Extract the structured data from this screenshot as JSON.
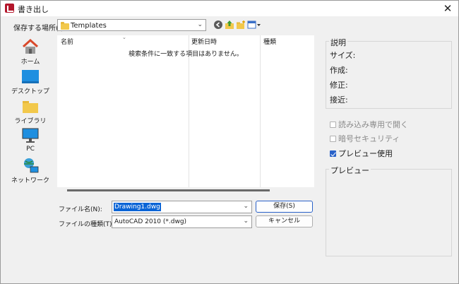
{
  "window": {
    "title": "書き出し"
  },
  "save_in": {
    "label": "保存する場所(I):",
    "value": "Templates"
  },
  "places": [
    {
      "label": "ホーム",
      "icon": "home-icon"
    },
    {
      "label": "デスクトップ",
      "icon": "desktop-icon"
    },
    {
      "label": "ライブラリ",
      "icon": "library-folder-icon"
    },
    {
      "label": "PC",
      "icon": "pc-monitor-icon"
    },
    {
      "label": "ネットワーク",
      "icon": "network-icon"
    }
  ],
  "file_list": {
    "columns": [
      "名前",
      "更新日時",
      "種類"
    ],
    "empty_message": "検索条件に一致する項目はありません。"
  },
  "filename": {
    "label": "ファイル名(N):",
    "value": "Drawing1.dwg"
  },
  "filetype": {
    "label": "ファイルの種類(T):",
    "value": "AutoCAD 2010 (*.dwg)"
  },
  "buttons": {
    "save": "保存(S)",
    "cancel": "キャンセル"
  },
  "description": {
    "title": "説明",
    "size_label": "サイズ:",
    "created_label": "作成:",
    "modified_label": "修正:",
    "accessed_label": "接近:"
  },
  "options": {
    "read_only": {
      "label": "読み込み専用で開く",
      "checked": false,
      "enabled": false
    },
    "encryption": {
      "label": "暗号セキュリティ",
      "checked": false,
      "enabled": false
    },
    "preview": {
      "label": "プレビュー使用",
      "checked": true,
      "enabled": true
    }
  },
  "preview": {
    "title": "プレビュー"
  },
  "colors": {
    "accent": "#2a62c9",
    "selection": "#0a64d6",
    "folder": "#f2c84b",
    "app_logo": "#b3162b"
  }
}
